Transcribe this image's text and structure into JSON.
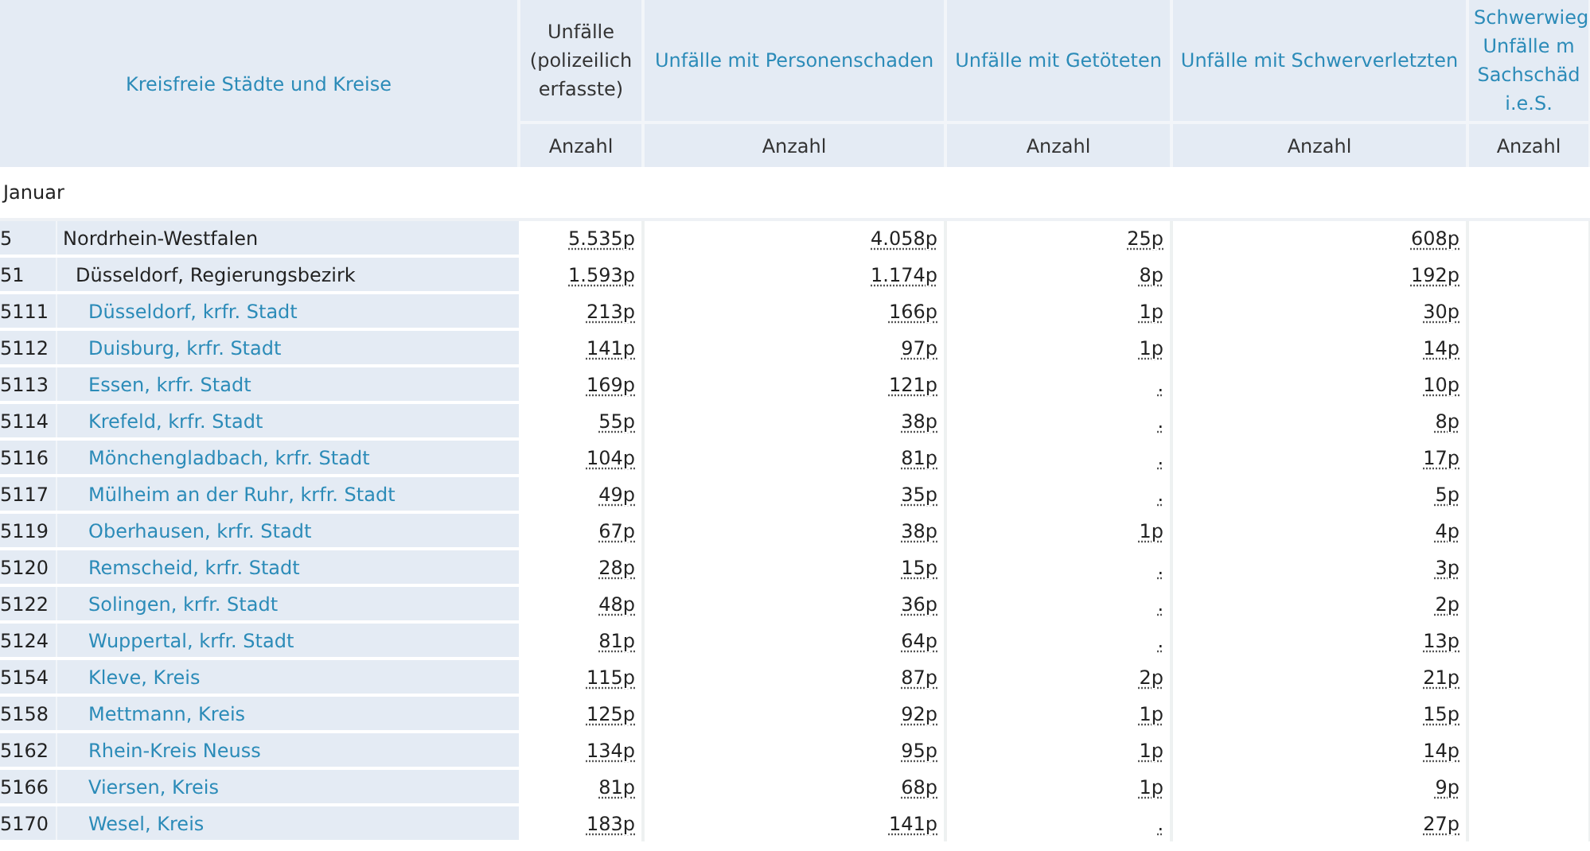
{
  "table": {
    "header": {
      "region_column": "Kreisfreie Städte und Kreise",
      "columns": [
        {
          "lines": [
            "Unfälle (polizeilich erfasste)"
          ],
          "unit": "Anzahl"
        },
        {
          "lines": [
            "Unfälle mit Personenschaden"
          ],
          "unit": "Anzahl"
        },
        {
          "lines": [
            "Unfälle mit Getöteten"
          ],
          "unit": "Anzahl"
        },
        {
          "lines": [
            "Unfälle mit Schwerverletzten"
          ],
          "unit": "Anzahl"
        },
        {
          "lines": [
            "Schwerwieg",
            "Unfälle m",
            "Sachschäd",
            "i.e.S."
          ],
          "unit": "Anzahl"
        }
      ]
    },
    "group": "Januar",
    "rows": [
      {
        "code": "5",
        "name": "Nordrhein-Westfalen",
        "values": [
          "5.535p",
          "4.058p",
          "25p",
          "608p"
        ],
        "children": [
          {
            "code": "51",
            "name": "Düsseldorf, Regierungsbezirk",
            "values": [
              "1.593p",
              "1.174p",
              "8p",
              "192p"
            ],
            "children": [
              {
                "code": "5111",
                "name": "Düsseldorf, krfr. Stadt",
                "values": [
                  "213p",
                  "166p",
                  "1p",
                  "30p"
                ]
              },
              {
                "code": "5112",
                "name": "Duisburg, krfr. Stadt",
                "values": [
                  "141p",
                  "97p",
                  "1p",
                  "14p"
                ]
              },
              {
                "code": "5113",
                "name": "Essen, krfr. Stadt",
                "values": [
                  "169p",
                  "121p",
                  ".",
                  "10p"
                ]
              },
              {
                "code": "5114",
                "name": "Krefeld, krfr. Stadt",
                "values": [
                  "55p",
                  "38p",
                  ".",
                  "8p"
                ]
              },
              {
                "code": "5116",
                "name": "Mönchengladbach, krfr. Stadt",
                "values": [
                  "104p",
                  "81p",
                  ".",
                  "17p"
                ]
              },
              {
                "code": "5117",
                "name": "Mülheim an der Ruhr, krfr. Stadt",
                "values": [
                  "49p",
                  "35p",
                  ".",
                  "5p"
                ]
              },
              {
                "code": "5119",
                "name": "Oberhausen, krfr. Stadt",
                "values": [
                  "67p",
                  "38p",
                  "1p",
                  "4p"
                ]
              },
              {
                "code": "5120",
                "name": "Remscheid, krfr. Stadt",
                "values": [
                  "28p",
                  "15p",
                  ".",
                  "3p"
                ]
              },
              {
                "code": "5122",
                "name": "Solingen, krfr. Stadt",
                "values": [
                  "48p",
                  "36p",
                  ".",
                  "2p"
                ]
              },
              {
                "code": "5124",
                "name": "Wuppertal, krfr. Stadt",
                "values": [
                  "81p",
                  "64p",
                  ".",
                  "13p"
                ]
              },
              {
                "code": "5154",
                "name": "Kleve, Kreis",
                "values": [
                  "115p",
                  "87p",
                  "2p",
                  "21p"
                ]
              },
              {
                "code": "5158",
                "name": "Mettmann, Kreis",
                "values": [
                  "125p",
                  "92p",
                  "1p",
                  "15p"
                ]
              },
              {
                "code": "5162",
                "name": "Rhein-Kreis Neuss",
                "values": [
                  "134p",
                  "95p",
                  "1p",
                  "14p"
                ]
              },
              {
                "code": "5166",
                "name": "Viersen, Kreis",
                "values": [
                  "81p",
                  "68p",
                  "1p",
                  "9p"
                ]
              },
              {
                "code": "5170",
                "name": "Wesel, Kreis",
                "values": [
                  "183p",
                  "141p",
                  ".",
                  "27p"
                ]
              }
            ]
          }
        ]
      }
    ]
  }
}
